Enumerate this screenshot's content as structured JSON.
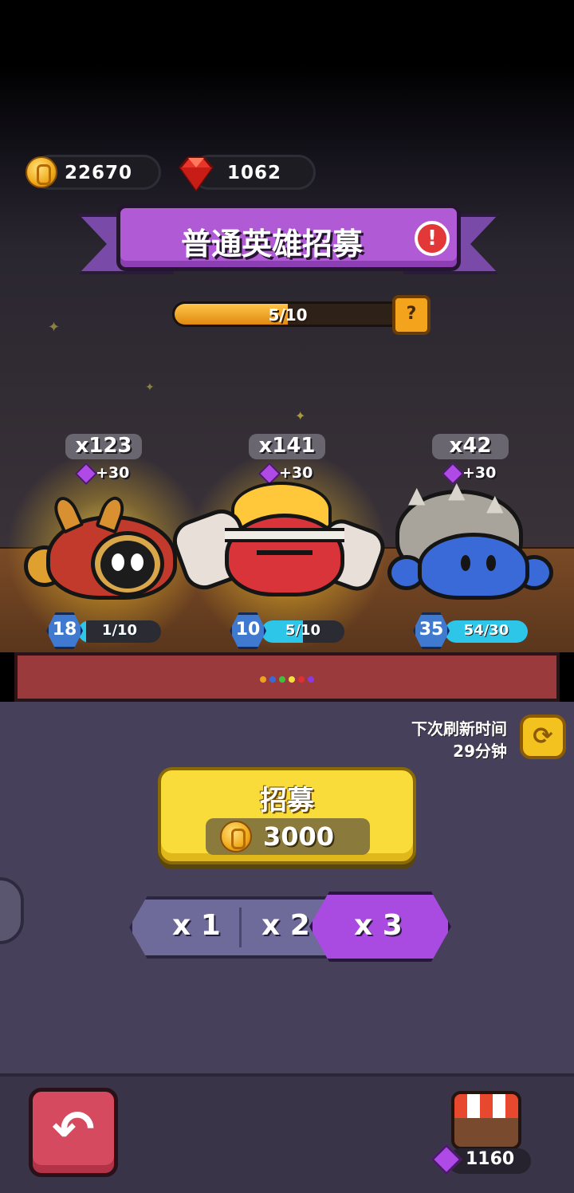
{
  "currency": {
    "coins": "22670",
    "gems": "1062",
    "coin_icon": "gold-coin-icon",
    "gem_icon": "red-ruby-icon"
  },
  "banner": {
    "title": "普通英雄招募",
    "alert_icon": "!"
  },
  "progress": {
    "label": "5/10",
    "fraction": 0.5,
    "help_label": "?"
  },
  "heroes": [
    {
      "count": "x123",
      "bonus": "+30",
      "level": "18",
      "progress": "1/10",
      "fraction": 0.1,
      "color": "#c23a2c"
    },
    {
      "count": "x141",
      "bonus": "+30",
      "level": "10",
      "progress": "5/10",
      "fraction": 0.5,
      "color": "#d8343a"
    },
    {
      "count": "x42",
      "bonus": "+30",
      "level": "35",
      "progress": "54/30",
      "fraction": 1.0,
      "color": "#3a6ad8"
    }
  ],
  "refresh": {
    "line1": "下次刷新时间",
    "line2": "29分钟"
  },
  "recruit": {
    "label": "招募",
    "cost": "3000"
  },
  "multipliers": {
    "options": [
      "x 1",
      "x 2",
      "x 3"
    ],
    "selected": "x 3"
  },
  "footer": {
    "shop_gems": "1160"
  },
  "colors": {
    "accent_purple": "#b05ad6",
    "button_yellow": "#f9dc3a",
    "back_red": "#d64a60"
  }
}
